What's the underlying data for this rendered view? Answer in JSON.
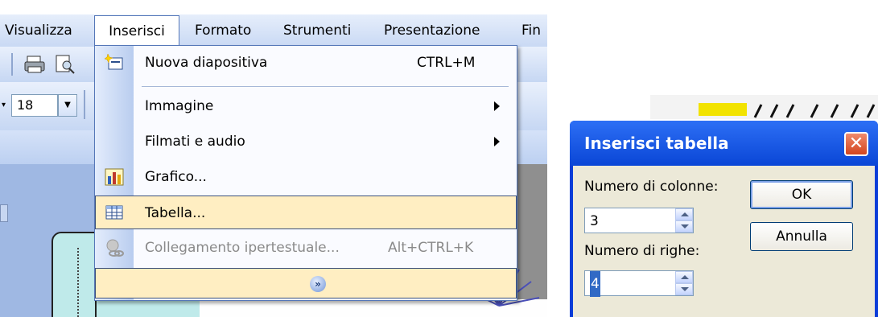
{
  "menubar": {
    "items": [
      "Visualizza",
      "Inserisci",
      "Formato",
      "Strumenti",
      "Presentazione",
      "Fin"
    ]
  },
  "toolbar": {
    "font_size": "18"
  },
  "insert_menu": {
    "items": [
      {
        "label": "Nuova diapositiva",
        "shortcut": "CTRL+M",
        "icon": "new-slide-icon"
      },
      {
        "label": "Immagine",
        "submenu": true
      },
      {
        "label": "Filmati e audio",
        "submenu": true
      },
      {
        "label": "Grafico...",
        "icon": "chart-icon"
      },
      {
        "label": "Tabella...",
        "icon": "table-icon",
        "highlighted": true
      },
      {
        "label": "Collegamento ipertestuale...",
        "shortcut": "Alt+CTRL+K",
        "icon": "hyperlink-icon",
        "disabled": true
      }
    ],
    "expand_glyph": "»"
  },
  "dialog": {
    "title": "Inserisci tabella",
    "columns_label": "Numero di colonne:",
    "columns_value": "3",
    "rows_label": "Numero di righe:",
    "rows_value": "4",
    "ok_label": "OK",
    "cancel_label": "Annulla",
    "close_glyph": "✕"
  },
  "colors": {
    "menu_highlight": "#ffeec2",
    "title_bar": "#0a46d6",
    "close_button": "#d3451e"
  }
}
